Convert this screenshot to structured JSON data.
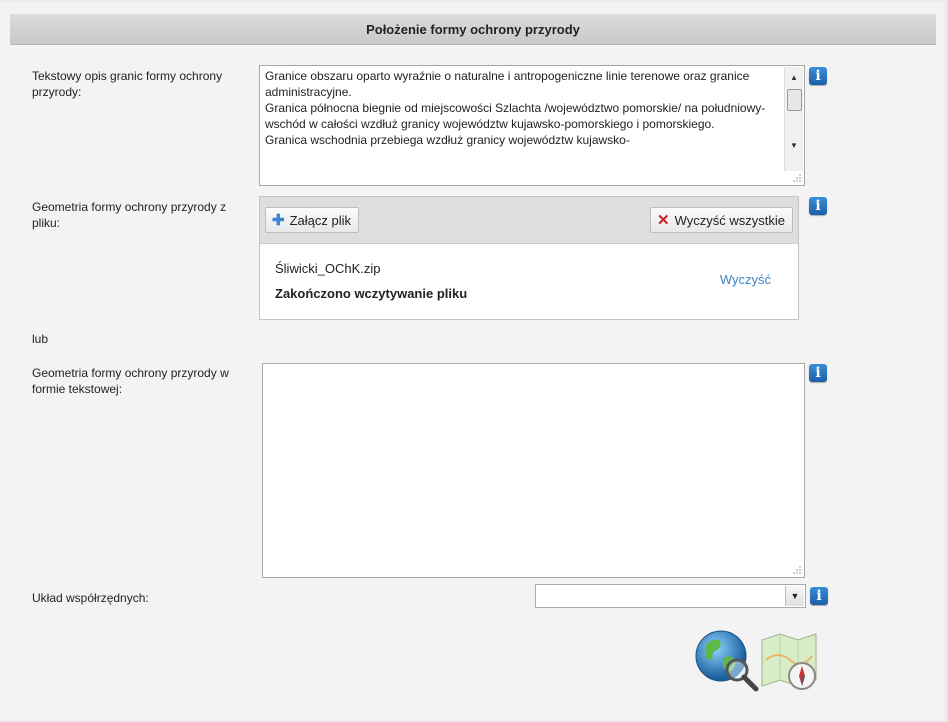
{
  "header": {
    "title": "Położenie formy ochrony przyrody"
  },
  "description": {
    "label": "Tekstowy opis granic formy ochrony przyrody:",
    "text": "Granice obszaru oparto wyraźnie o naturalne i antropogeniczne linie terenowe oraz granice administracyjne.\nGranica północna biegnie od miejscowości Szlachta /województwo pomorskie/ na południowy-wschód w całości wzdłuż granicy województw kujawsko-pomorskiego i pomorskiego.\nGranica wschodnia przebiega wzdłuż granicy województw kujawsko-",
    "info_icon": "info-icon"
  },
  "geometry_file": {
    "label": "Geometria formy ochrony przyrody z pliku:",
    "attach_label": "Załącz plik",
    "clear_all_label": "Wyczyść wszystkie",
    "file_name": "Śliwicki_OChK.zip",
    "status": "Zakończono wczytywanie pliku",
    "clear_label": "Wyczyść",
    "colors": {
      "link": "#3d86c6",
      "plus": "#3a87d4",
      "cross": "#cc2222"
    }
  },
  "or_label": "lub",
  "geometry_text": {
    "label": "Geometria formy ochrony przyrody w formie tekstowej:",
    "value": ""
  },
  "crs": {
    "label": "Układ współrzędnych:",
    "selected": ""
  },
  "icons": [
    "globe-search-icon",
    "map-compass-icon"
  ]
}
